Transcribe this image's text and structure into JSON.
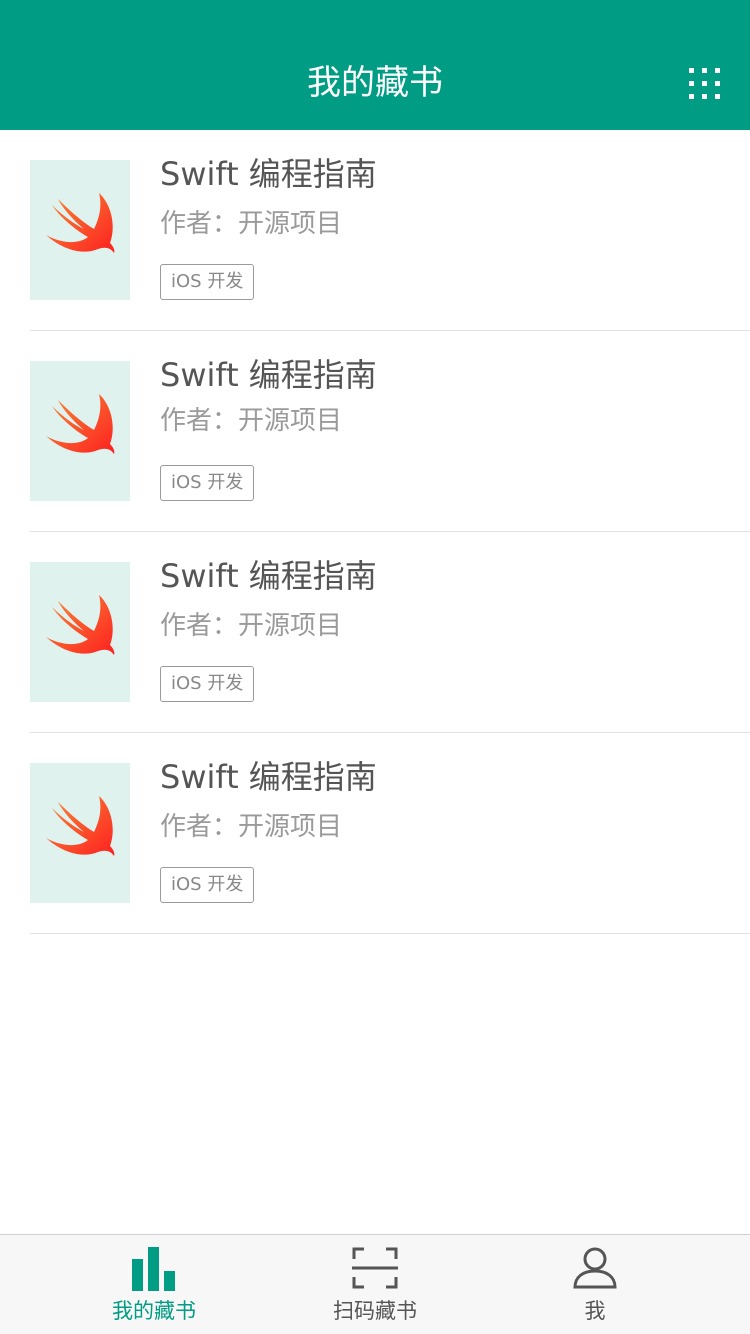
{
  "header": {
    "title": "我的藏书",
    "menu_icon": "grid-icon"
  },
  "colors": {
    "primary": "#009d84",
    "cover_bg": "#dff2ee",
    "swift_orange": "#f05138"
  },
  "books": [
    {
      "title": "Swift 编程指南",
      "author": "作者：开源项目",
      "tag": "iOS 开发",
      "cover_icon": "swift-logo-icon"
    },
    {
      "title": "Swift 编程指南",
      "author": "作者：开源项目",
      "tag": "iOS 开发",
      "cover_icon": "swift-logo-icon"
    },
    {
      "title": "Swift 编程指南",
      "author": "作者：开源项目",
      "tag": "iOS 开发",
      "cover_icon": "swift-logo-icon"
    },
    {
      "title": "Swift 编程指南",
      "author": "作者：开源项目",
      "tag": "iOS 开发",
      "cover_icon": "swift-logo-icon"
    }
  ],
  "tabbar": {
    "tabs": [
      {
        "label": "我的藏书",
        "icon": "bar-chart-icon",
        "active": true
      },
      {
        "label": "扫码藏书",
        "icon": "scan-icon",
        "active": false
      },
      {
        "label": "我",
        "icon": "user-icon",
        "active": false
      }
    ]
  }
}
